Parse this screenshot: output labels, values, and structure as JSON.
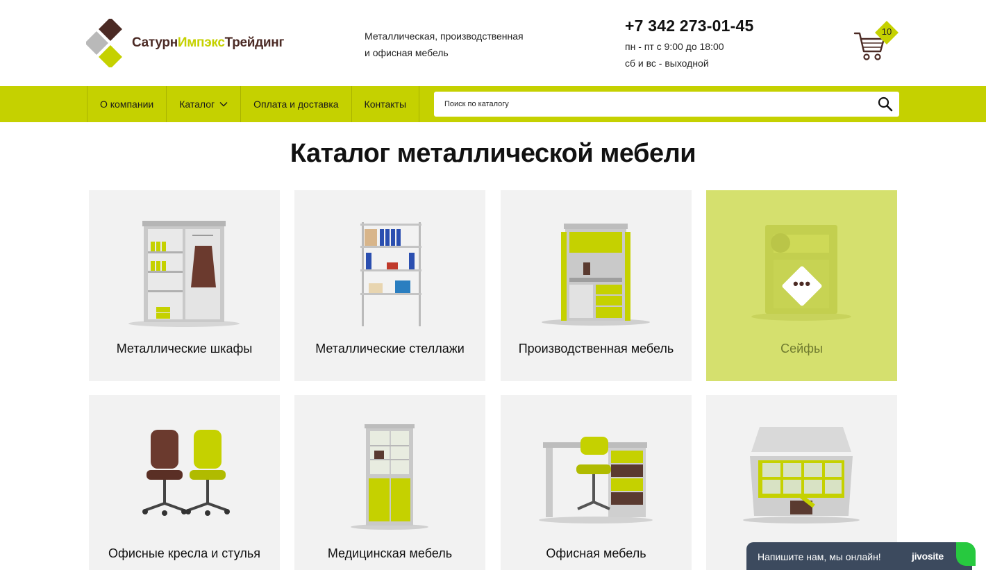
{
  "header": {
    "logo": {
      "word1": "Сатурн",
      "word2": "Импэкс",
      "word3": "Трейдинг"
    },
    "tagline_line1": "Металлическая, производственная",
    "tagline_line2": "и офисная мебель",
    "phone": "+7 342 273-01-45",
    "hours_weekdays": "пн - пт с 9:00 до 18:00",
    "hours_weekend": "сб и вс - выходной",
    "cart_count": "10"
  },
  "nav": {
    "items": [
      {
        "label": "О компании"
      },
      {
        "label": "Каталог"
      },
      {
        "label": "Оплата и доставка"
      },
      {
        "label": "Контакты"
      }
    ],
    "search_placeholder": "Поиск по каталогу"
  },
  "main": {
    "title": "Каталог металлической мебели",
    "cards": [
      {
        "label": "Металлические шкафы"
      },
      {
        "label": "Металлические стеллажи"
      },
      {
        "label": "Производственная мебель"
      },
      {
        "label": "Сейфы"
      },
      {
        "label": "Офисные кресла и стулья"
      },
      {
        "label": "Медицинская мебель"
      },
      {
        "label": "Офисная мебель"
      },
      {
        "label": ""
      }
    ],
    "active_badge": "•••"
  },
  "chat": {
    "message": "Напишите нам, мы онлайн!",
    "brand": "jivosite"
  },
  "colors": {
    "accent": "#c5d100",
    "brand_brown": "#4b2a24",
    "card_bg": "#f2f2f2",
    "card_active_bg": "#d5e06e",
    "chat_bg": "#3c4a5e"
  },
  "icons": {
    "search": "search-icon",
    "cart": "cart-icon",
    "chevron": "chevron-down-icon",
    "more": "more-dots-icon"
  }
}
